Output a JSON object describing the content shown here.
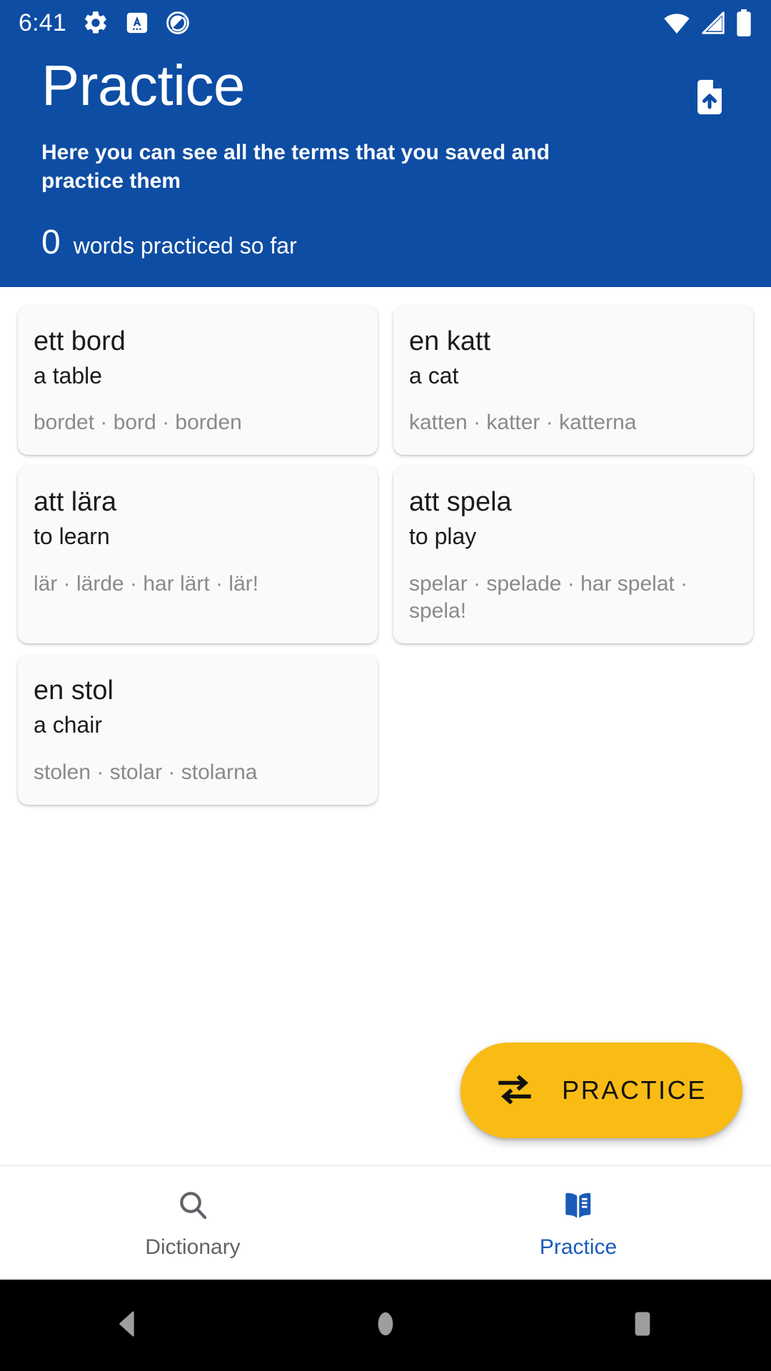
{
  "status_bar": {
    "clock": "6:41",
    "left_icons": [
      "settings-gear-icon",
      "android-auto-icon",
      "screen-record-icon"
    ],
    "right_icons": [
      "wifi-icon",
      "cellular-signal-icon",
      "battery-icon"
    ]
  },
  "header": {
    "title": "Practice",
    "subtitle": "Here you can see all the terms that you saved and practice them",
    "count_value": "0",
    "count_label": "words practiced so far",
    "export_icon": "file-upload-icon",
    "background_color": "#0E4DA4"
  },
  "cards": [
    {
      "term": "ett bord",
      "translation": "a table",
      "forms": "bordet · bord · borden"
    },
    {
      "term": "en katt",
      "translation": "a cat",
      "forms": "katten · katter · katterna"
    },
    {
      "term": "att lära",
      "translation": "to learn",
      "forms": "lär · lärde · har lärt · lär!"
    },
    {
      "term": "att spela",
      "translation": "to play",
      "forms": "spelar · spelade · har spelat · spela!"
    },
    {
      "term": "en stol",
      "translation": "a chair",
      "forms": "stolen · stolar · stolarna"
    }
  ],
  "practice_button": {
    "label": "PRACTICE",
    "icon": "repeat-swap-icon",
    "color": "#F9BC15"
  },
  "bottom_nav": {
    "items": [
      {
        "label": "Dictionary",
        "icon": "search-icon",
        "active": false
      },
      {
        "label": "Practice",
        "icon": "open-book-icon",
        "active": true
      }
    ],
    "active_color": "#1A5BB8",
    "inactive_color": "#5F6368"
  },
  "system_nav": {
    "back": "back-triangle-icon",
    "home": "home-circle-icon",
    "recents": "recents-square-icon"
  }
}
